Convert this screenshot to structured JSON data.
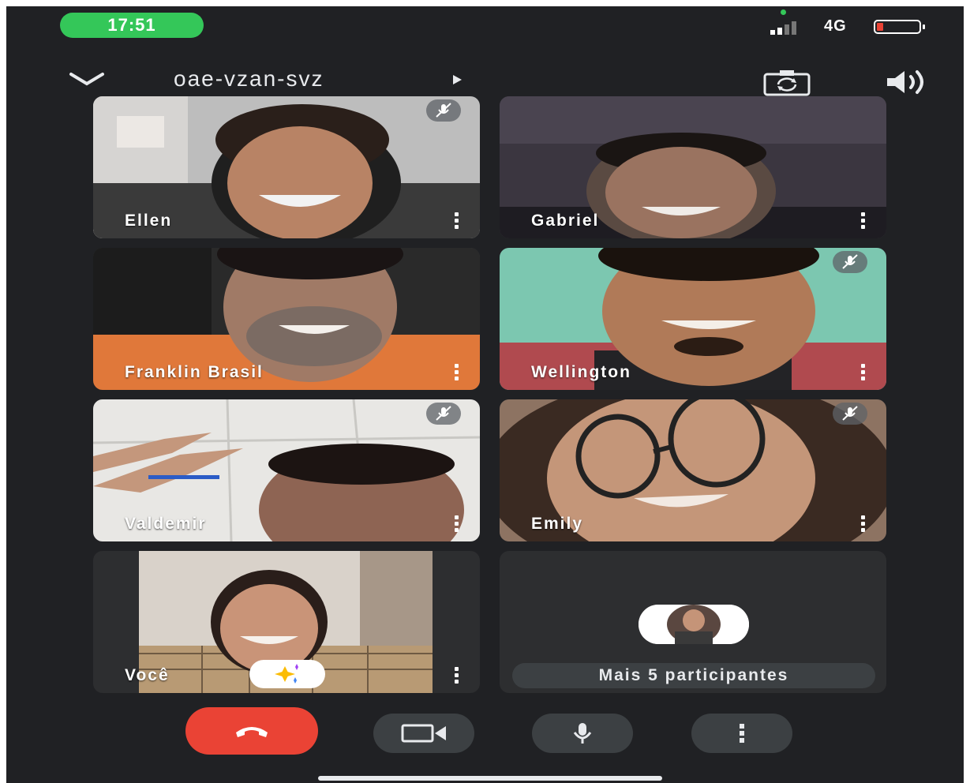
{
  "status_bar": {
    "time": "17:51",
    "network": "4G",
    "battery_level": 0.15,
    "battery_color": "#ea4335"
  },
  "header": {
    "meeting_code": "oae-vzan-svz",
    "icons": [
      "chevron-down-icon",
      "play-arrow-icon",
      "switch-camera-icon",
      "speaker-icon"
    ]
  },
  "participants": [
    {
      "name": "Ellen",
      "muted": true
    },
    {
      "name": "Gabriel",
      "muted": false
    },
    {
      "name": "Franklin Brasil",
      "muted": false
    },
    {
      "name": "Wellington",
      "muted": true
    },
    {
      "name": "Valdemir",
      "muted": true
    },
    {
      "name": "Emily",
      "muted": true
    },
    {
      "name": "Você",
      "muted": false
    }
  ],
  "overflow": {
    "label": "Mais 5 participantes"
  },
  "controls": {
    "end_call_color": "#ea4335",
    "buttons": [
      "end-call-icon",
      "camera-icon",
      "microphone-icon",
      "more-options-icon"
    ]
  }
}
